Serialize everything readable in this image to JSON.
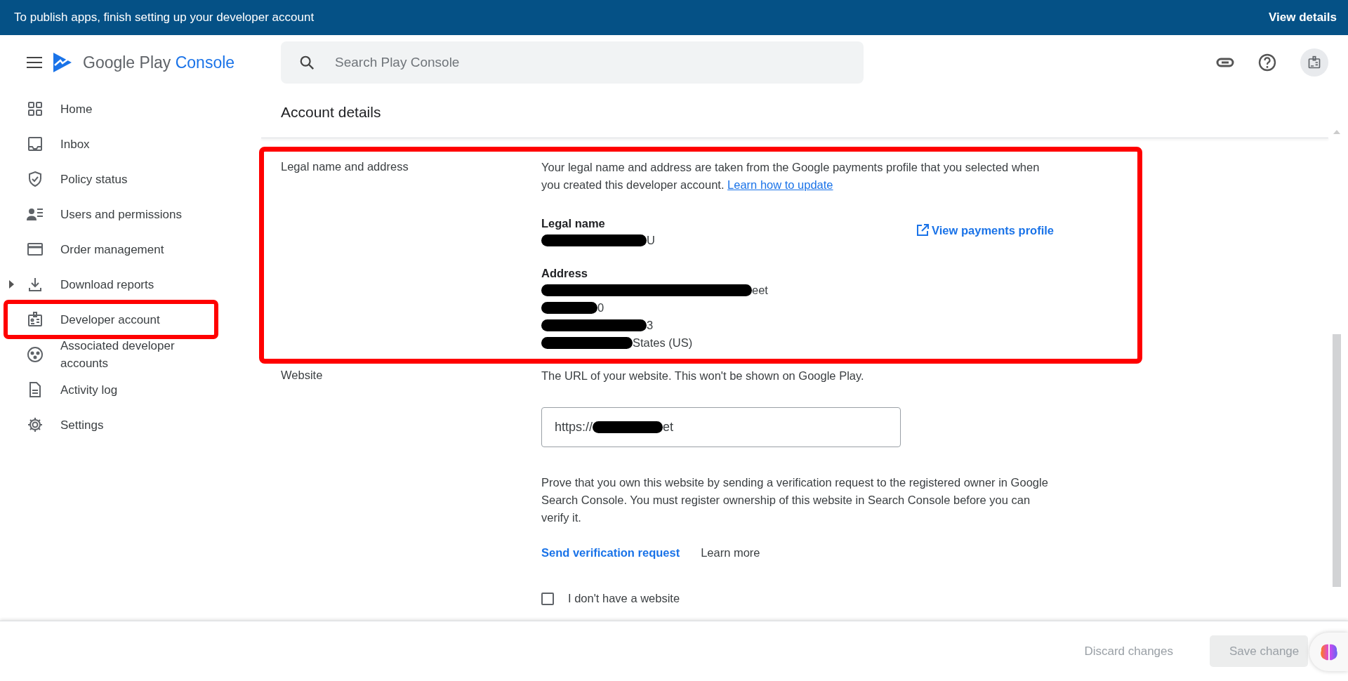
{
  "banner": {
    "message": "To publish apps, finish setting up your developer account",
    "action": "View details"
  },
  "header": {
    "logo_text": "Google Play",
    "logo_accent": "Console",
    "search": {
      "placeholder": "Search Play Console"
    }
  },
  "sidebar": {
    "items": [
      {
        "label": "Home",
        "kind": "grid",
        "expandable": false,
        "highlighted": false
      },
      {
        "label": "Inbox",
        "kind": "inbox",
        "expandable": false,
        "highlighted": false
      },
      {
        "label": "Policy status",
        "kind": "shield",
        "expandable": false,
        "highlighted": false
      },
      {
        "label": "Users and permissions",
        "kind": "users",
        "expandable": false,
        "highlighted": false
      },
      {
        "label": "Order management",
        "kind": "card",
        "expandable": false,
        "highlighted": false
      },
      {
        "label": "Download reports",
        "kind": "download",
        "expandable": true,
        "highlighted": false
      },
      {
        "label": "Developer account",
        "kind": "badge",
        "expandable": false,
        "highlighted": true
      },
      {
        "label": "Associated developer accounts",
        "kind": "circles",
        "expandable": false,
        "highlighted": false
      },
      {
        "label": "Activity log",
        "kind": "doc",
        "expandable": false,
        "highlighted": false
      },
      {
        "label": "Settings",
        "kind": "gear",
        "expandable": false,
        "highlighted": false
      }
    ]
  },
  "page_title": "Account details",
  "legal": {
    "label": "Legal name and address",
    "highlighted": true,
    "description": "Your legal name and address are taken from the Google payments profile that you selected when you created this developer account.",
    "link": "Learn how to update",
    "name_heading": "Legal name",
    "name_value": "U",
    "address_heading": "Address",
    "address_lines": [
      "eet",
      "0",
      "3",
      "States (US)"
    ],
    "profile_link": "View payments profile"
  },
  "website": {
    "label": "Website",
    "description": "The URL of your website. This won't be shown on Google Play.",
    "value": "https://",
    "value_end": "et",
    "verify_text": "Prove that you own this website by sending a verification request to the registered owner in Google Search Console. You must register ownership of this website in Search Console before you can verify it.",
    "verify_link": "Send verification request",
    "learn_more": "Learn more",
    "no_website": {
      "label": "I don't have a website",
      "checked": false
    }
  },
  "footer": {
    "discard": "Discard changes",
    "save": "Save change",
    "save_disabled": true
  }
}
